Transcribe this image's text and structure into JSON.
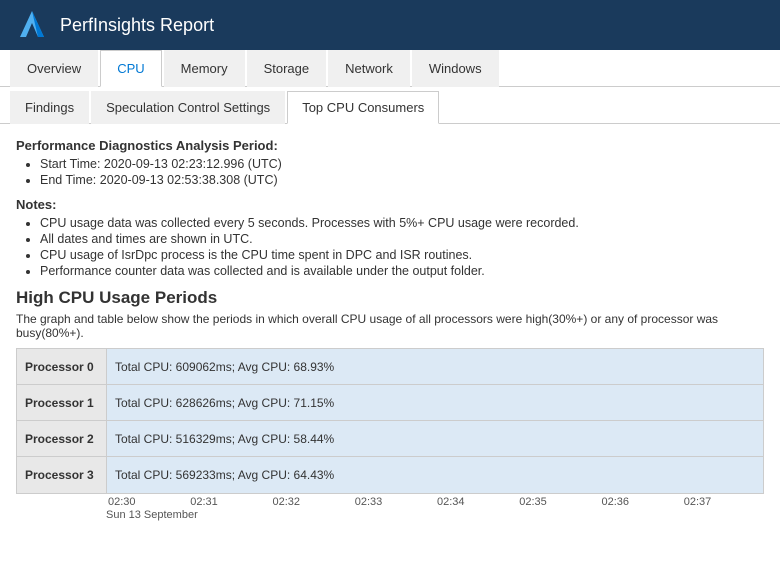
{
  "header": {
    "title": "PerfInsights Report",
    "logo_alt": "Azure Logo"
  },
  "top_nav": {
    "tabs": [
      {
        "label": "Overview",
        "active": false
      },
      {
        "label": "CPU",
        "active": true
      },
      {
        "label": "Memory",
        "active": false
      },
      {
        "label": "Storage",
        "active": false
      },
      {
        "label": "Network",
        "active": false
      },
      {
        "label": "Windows",
        "active": false
      }
    ]
  },
  "sub_nav": {
    "tabs": [
      {
        "label": "Findings",
        "active": false
      },
      {
        "label": "Speculation Control Settings",
        "active": false
      },
      {
        "label": "Top CPU Consumers",
        "active": true
      }
    ]
  },
  "content": {
    "analysis_period_label": "Performance Diagnostics Analysis Period:",
    "start_time": "Start Time: 2020-09-13 02:23:12.996 (UTC)",
    "end_time": "End Time: 2020-09-13 02:53:38.308 (UTC)",
    "notes_label": "Notes:",
    "notes": [
      "CPU usage data was collected every 5 seconds. Processes with 5%+ CPU usage were recorded.",
      "All dates and times are shown in UTC.",
      "CPU usage of IsrDpc process is the CPU time spent in DPC and ISR routines.",
      "Performance counter data was collected and is available under the output folder."
    ],
    "high_cpu_title": "High CPU Usage Periods",
    "high_cpu_desc": "The graph and table below show the periods in which overall CPU usage of all processors were high(30%+) or any of processor was busy(80%+).",
    "processors": [
      {
        "label": "Processor 0",
        "stats": "Total CPU: 609062ms; Avg CPU: 68.93%",
        "pct": 68.93
      },
      {
        "label": "Processor 1",
        "stats": "Total CPU: 628626ms; Avg CPU: 71.15%",
        "pct": 71.15
      },
      {
        "label": "Processor 2",
        "stats": "Total CPU: 516329ms; Avg CPU: 58.44%",
        "pct": 58.44
      },
      {
        "label": "Processor 3",
        "stats": "Total CPU: 569233ms; Avg CPU: 64.43%",
        "pct": 64.43
      }
    ],
    "timeline_ticks": [
      "02:30",
      "02:31",
      "02:32",
      "02:33",
      "02:34",
      "02:35",
      "02:36",
      "02:37"
    ],
    "timeline_date": "Sun 13 September"
  }
}
